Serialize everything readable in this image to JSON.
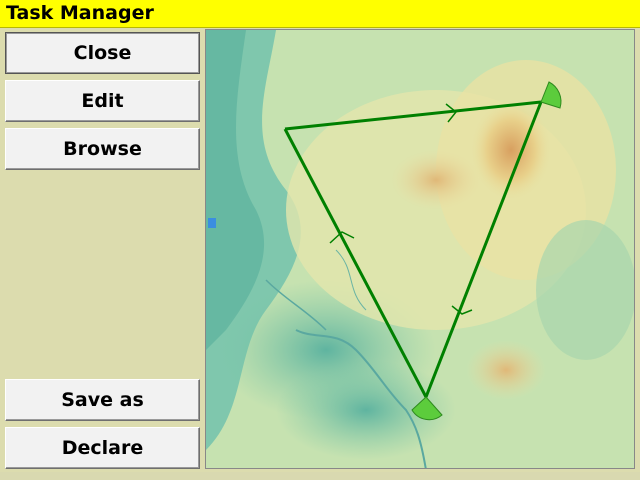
{
  "window": {
    "title": "Task Manager"
  },
  "buttons": {
    "close": "Close",
    "edit": "Edit",
    "browse": "Browse",
    "save_as": "Save as",
    "declare": "Declare"
  },
  "colors": {
    "title_bar": "#ffff00",
    "sidebar": "#dcdcae",
    "task_line": "#008000",
    "sector": "#5ccc3c"
  },
  "map": {
    "task": {
      "turnpoints": 3,
      "leg_count": 3
    }
  }
}
